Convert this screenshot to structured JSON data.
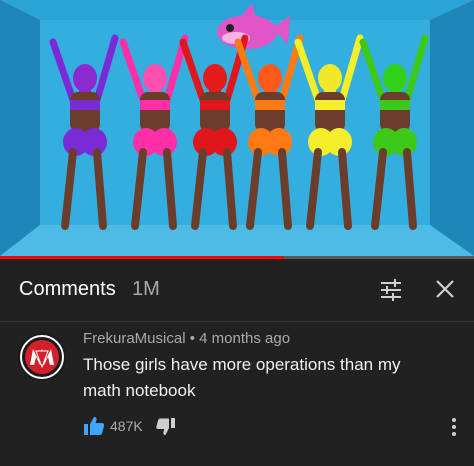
{
  "video": {
    "description_icon": "video-frame",
    "progress_fraction": 0.6
  },
  "comments_panel": {
    "title": "Comments",
    "count": "1M",
    "sort_icon": "sort-sliders-icon",
    "close_icon": "close-icon"
  },
  "comment": {
    "author": "FrekuraMusical",
    "separator": "•",
    "time": "4 months ago",
    "text": "Those girls have more operations than my math notebook",
    "like_count": "487K",
    "like_icon": "thumbs-up-icon",
    "dislike_icon": "thumbs-down-icon",
    "more_icon": "more-vertical-icon"
  },
  "colors": {
    "background": "#212121",
    "accent_blue": "#3ea6ff",
    "progress_red": "#ff0000",
    "muted_text": "#aaaaaa"
  }
}
